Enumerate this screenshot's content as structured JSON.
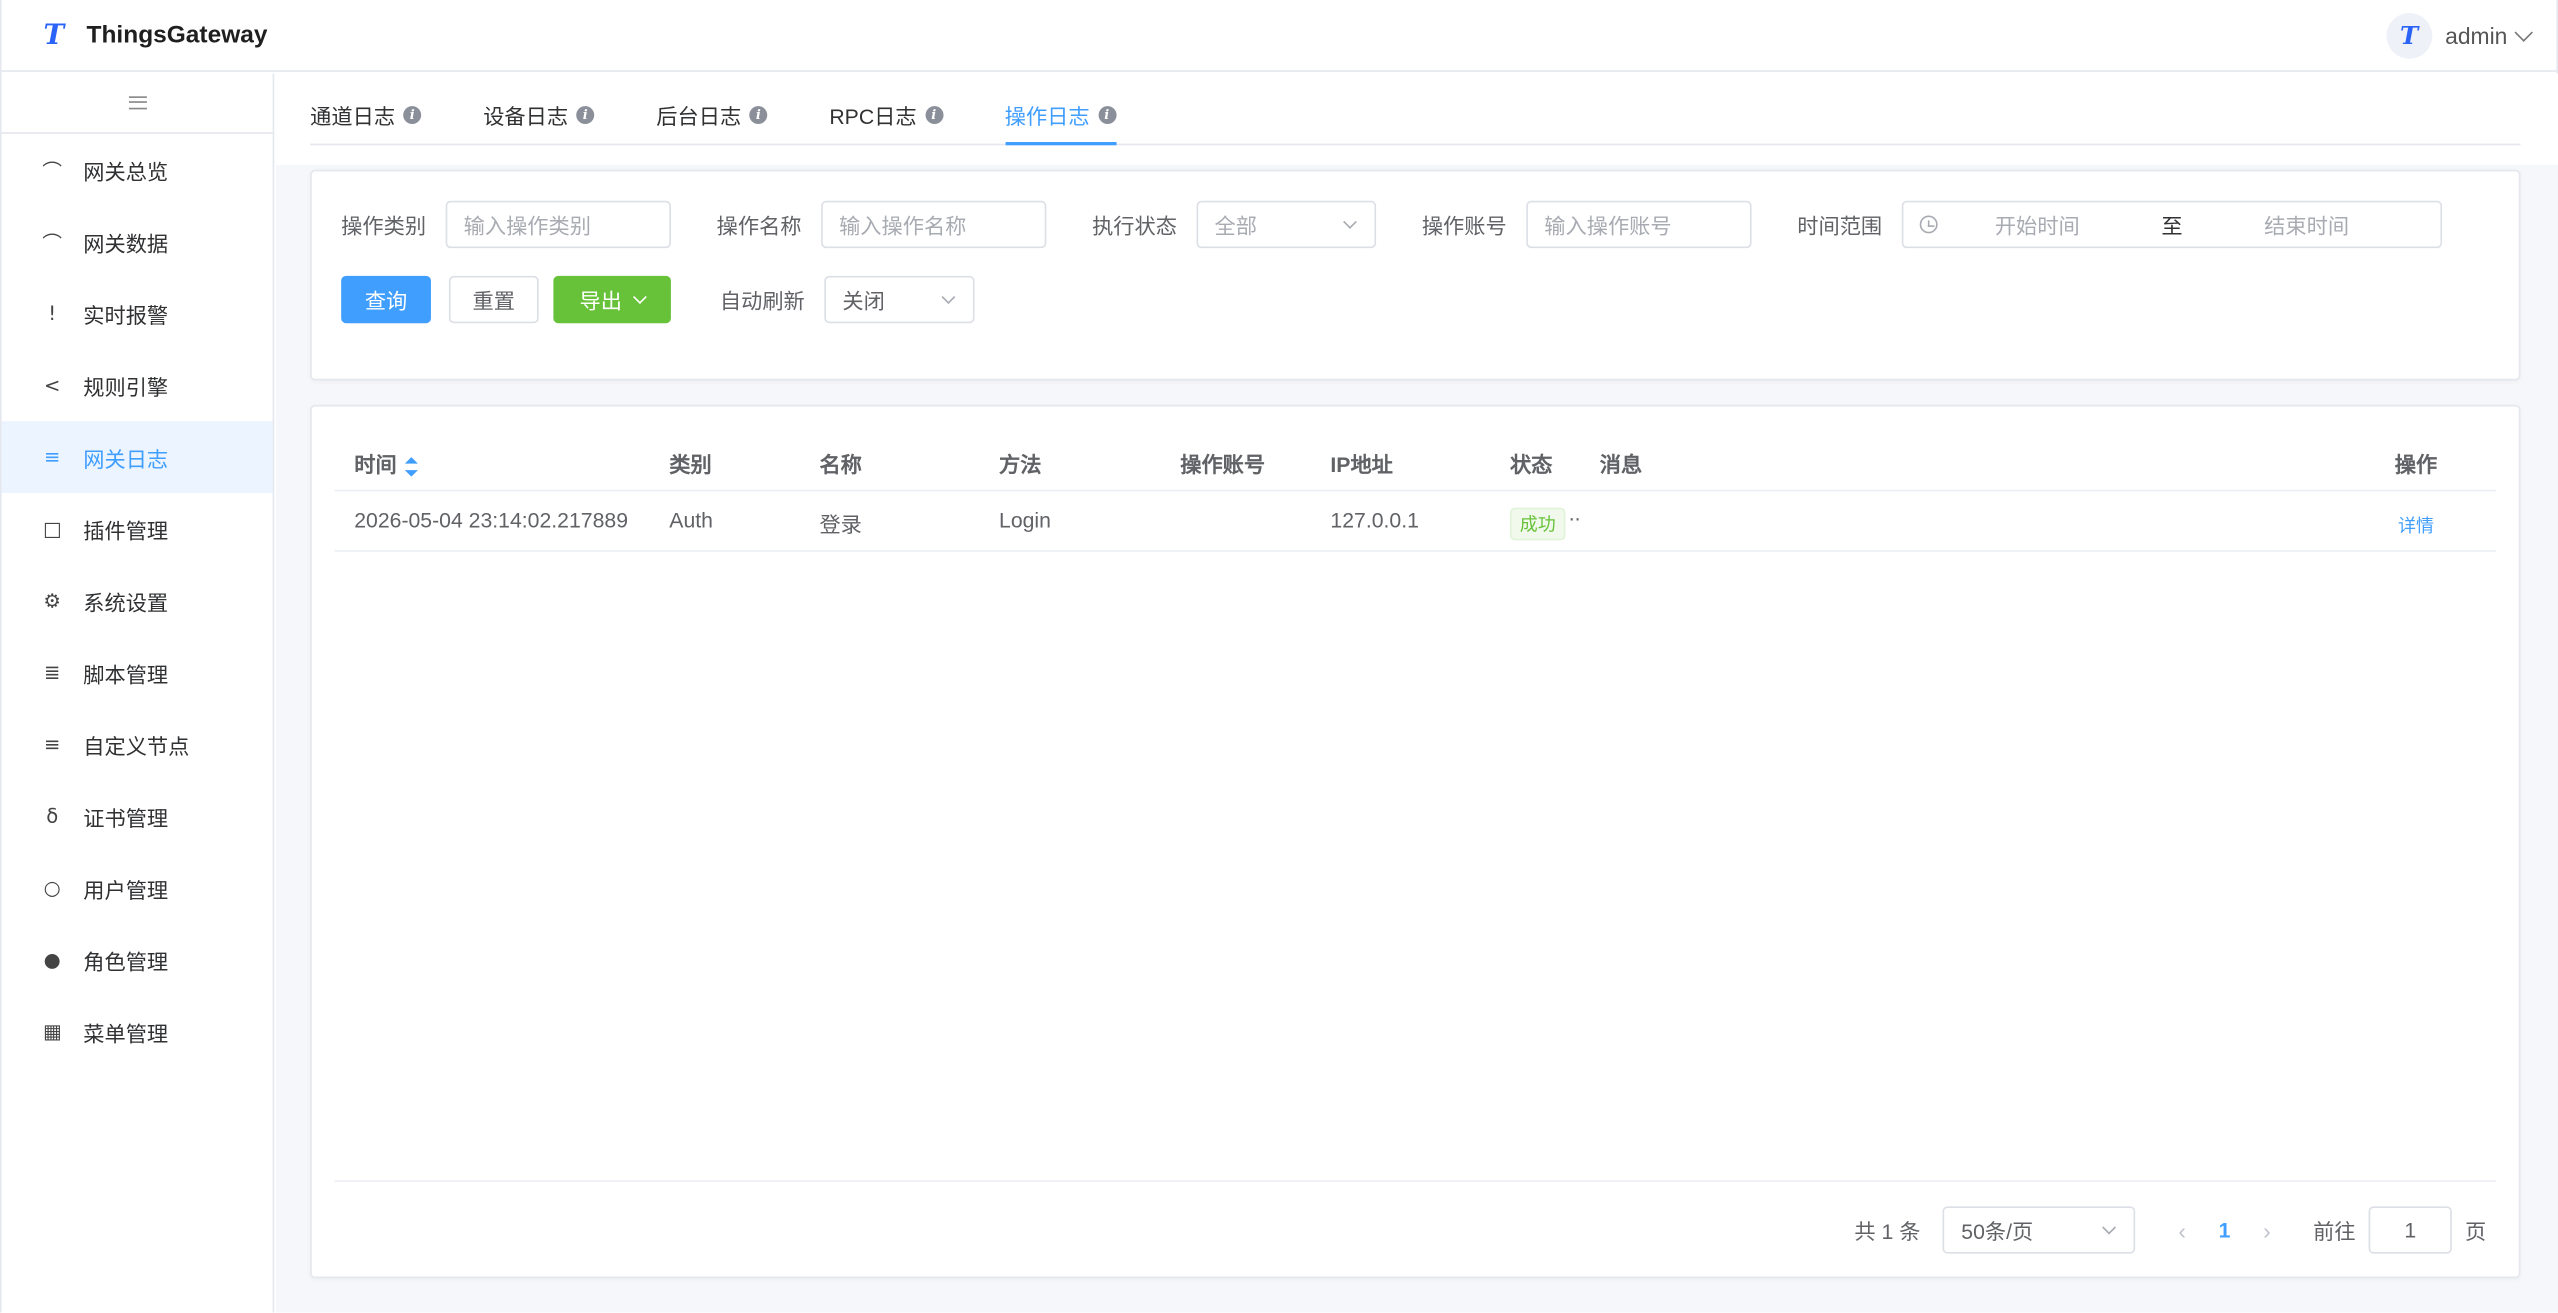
{
  "header": {
    "brand": "ThingsGateway",
    "logo_glyph": "T",
    "username": "admin"
  },
  "sidebar": {
    "items": [
      {
        "label": "网关总览",
        "icon": "monitor-icon",
        "glyph": "⌒"
      },
      {
        "label": "网关数据",
        "icon": "chart-monitor-icon",
        "glyph": "⌒"
      },
      {
        "label": "实时报警",
        "icon": "alert-circle-icon",
        "glyph": "!"
      },
      {
        "label": "规则引擎",
        "icon": "share-icon",
        "glyph": "<"
      },
      {
        "label": "网关日志",
        "icon": "document-icon",
        "glyph": "≡",
        "active": true
      },
      {
        "label": "插件管理",
        "icon": "package-icon",
        "glyph": "□"
      },
      {
        "label": "系统设置",
        "icon": "gear-icon",
        "glyph": "⚙"
      },
      {
        "label": "脚本管理",
        "icon": "file-text-icon",
        "glyph": "≣"
      },
      {
        "label": "自定义节点",
        "icon": "sliders-icon",
        "glyph": "≡"
      },
      {
        "label": "证书管理",
        "icon": "key-icon",
        "glyph": "δ"
      },
      {
        "label": "用户管理",
        "icon": "user-icon",
        "glyph": "○"
      },
      {
        "label": "角色管理",
        "icon": "user-filled-icon",
        "glyph": "●"
      },
      {
        "label": "菜单管理",
        "icon": "grid-icon",
        "glyph": "▦"
      }
    ]
  },
  "tabs": [
    {
      "label": "通道日志"
    },
    {
      "label": "设备日志"
    },
    {
      "label": "后台日志"
    },
    {
      "label": "RPC日志"
    },
    {
      "label": "操作日志",
      "active": true
    }
  ],
  "search": {
    "category_label": "操作类别",
    "category_placeholder": "输入操作类别",
    "name_label": "操作名称",
    "name_placeholder": "输入操作名称",
    "status_label": "执行状态",
    "status_value": "全部",
    "account_label": "操作账号",
    "account_placeholder": "输入操作账号",
    "time_label": "时间范围",
    "time_start": "开始时间",
    "time_sep": "至",
    "time_end": "结束时间",
    "query_btn": "查询",
    "reset_btn": "重置",
    "export_btn": "导出",
    "autorefresh_label": "自动刷新",
    "autorefresh_value": "关闭"
  },
  "table": {
    "columns": [
      "时间",
      "类别",
      "名称",
      "方法",
      "操作账号",
      "IP地址",
      "状态",
      "消息",
      "操作"
    ],
    "rows": [
      {
        "time": "2026-05-04 23:14:02.217889",
        "category": "Auth",
        "name": "登录",
        "method": "Login",
        "account": "",
        "ip": "127.0.0.1",
        "status": "成功",
        "message": "..",
        "action": "详情"
      }
    ]
  },
  "pagination": {
    "total": "共 1 条",
    "page_size": "50条/页",
    "current_page": "1",
    "goto_label": "前往",
    "goto_value": "1",
    "page_suffix": "页"
  },
  "colors": {
    "accent": "#409eff",
    "success": "#67c23a",
    "brand": "#2a63f6"
  }
}
